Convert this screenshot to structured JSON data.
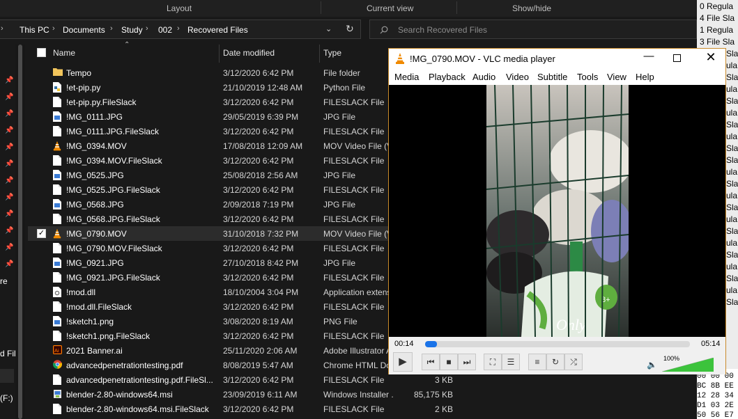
{
  "ribbon": {
    "layout": "Layout",
    "current_view": "Current view",
    "show_hide": "Show/hide"
  },
  "breadcrumbs": [
    "This PC",
    "Documents",
    "Study",
    "002",
    "Recovered Files"
  ],
  "search": {
    "placeholder": "Search Recovered Files"
  },
  "columns": {
    "name": "Name",
    "date": "Date modified",
    "type": "Type"
  },
  "files": [
    {
      "name": "Tempo",
      "date": "3/12/2020 6:42 PM",
      "type": "File folder",
      "size": "",
      "icon": "folder-icon",
      "selected": false
    },
    {
      "name": "!et-pip.py",
      "date": "21/10/2019 12:48 AM",
      "type": "Python File",
      "size": "",
      "icon": "python-file-icon",
      "selected": false
    },
    {
      "name": "!et-pip.py.FileSlack",
      "date": "3/12/2020 6:42 PM",
      "type": "FILESLACK File",
      "size": "",
      "icon": "document-icon",
      "selected": false
    },
    {
      "name": "!MG_0111.JPG",
      "date": "29/05/2019 6:39 PM",
      "type": "JPG File",
      "size": "",
      "icon": "image-file-icon",
      "selected": false
    },
    {
      "name": "!MG_0111.JPG.FileSlack",
      "date": "3/12/2020 6:42 PM",
      "type": "FILESLACK File",
      "size": "",
      "icon": "document-icon",
      "selected": false
    },
    {
      "name": "!MG_0394.MOV",
      "date": "17/08/2018 12:09 AM",
      "type": "MOV Video File (VLC)",
      "size": "",
      "icon": "vlc-cone-icon",
      "selected": false
    },
    {
      "name": "!MG_0394.MOV.FileSlack",
      "date": "3/12/2020 6:42 PM",
      "type": "FILESLACK File",
      "size": "",
      "icon": "document-icon",
      "selected": false
    },
    {
      "name": "!MG_0525.JPG",
      "date": "25/08/2018 2:56 AM",
      "type": "JPG File",
      "size": "",
      "icon": "image-file-icon",
      "selected": false
    },
    {
      "name": "!MG_0525.JPG.FileSlack",
      "date": "3/12/2020 6:42 PM",
      "type": "FILESLACK File",
      "size": "",
      "icon": "document-icon",
      "selected": false
    },
    {
      "name": "!MG_0568.JPG",
      "date": "2/09/2018 7:19 PM",
      "type": "JPG File",
      "size": "",
      "icon": "image-file-icon",
      "selected": false
    },
    {
      "name": "!MG_0568.JPG.FileSlack",
      "date": "3/12/2020 6:42 PM",
      "type": "FILESLACK File",
      "size": "",
      "icon": "document-icon",
      "selected": false
    },
    {
      "name": "!MG_0790.MOV",
      "date": "31/10/2018 7:32 PM",
      "type": "MOV Video File (VLC)",
      "size": "",
      "icon": "vlc-cone-icon",
      "selected": true
    },
    {
      "name": "!MG_0790.MOV.FileSlack",
      "date": "3/12/2020 6:42 PM",
      "type": "FILESLACK File",
      "size": "",
      "icon": "document-icon",
      "selected": false
    },
    {
      "name": "!MG_0921.JPG",
      "date": "27/10/2018 8:42 PM",
      "type": "JPG File",
      "size": "",
      "icon": "image-file-icon",
      "selected": false
    },
    {
      "name": "!MG_0921.JPG.FileSlack",
      "date": "3/12/2020 6:42 PM",
      "type": "FILESLACK File",
      "size": "",
      "icon": "document-icon",
      "selected": false
    },
    {
      "name": "!mod.dll",
      "date": "18/10/2004 3:04 PM",
      "type": "Application extension",
      "size": "",
      "icon": "dll-file-icon",
      "selected": false
    },
    {
      "name": "!mod.dll.FileSlack",
      "date": "3/12/2020 6:42 PM",
      "type": "FILESLACK File",
      "size": "",
      "icon": "document-icon",
      "selected": false
    },
    {
      "name": "!sketch1.png",
      "date": "3/08/2020 8:19 AM",
      "type": "PNG File",
      "size": "",
      "icon": "image-file-icon",
      "selected": false
    },
    {
      "name": "!sketch1.png.FileSlack",
      "date": "3/12/2020 6:42 PM",
      "type": "FILESLACK File",
      "size": "",
      "icon": "document-icon",
      "selected": false
    },
    {
      "name": "2021 Banner.ai",
      "date": "25/11/2020 2:06 AM",
      "type": "Adobe Illustrator Artwork",
      "size": "",
      "icon": "illustrator-icon",
      "selected": false
    },
    {
      "name": "advancedpenetrationtesting.pdf",
      "date": "8/08/2019 5:47 AM",
      "type": "Chrome HTML Document",
      "size": "",
      "icon": "chrome-icon",
      "selected": false
    },
    {
      "name": "advancedpenetrationtesting.pdf.FileSl...",
      "date": "3/12/2020 6:42 PM",
      "type": "FILESLACK File",
      "size": "3 KB",
      "icon": "document-icon",
      "selected": false
    },
    {
      "name": "blender-2.80-windows64.msi",
      "date": "23/09/2019 6:11 AM",
      "type": "Windows Installer ...",
      "size": "85,175 KB",
      "icon": "installer-icon",
      "selected": false
    },
    {
      "name": "blender-2.80-windows64.msi.FileSlack",
      "date": "3/12/2020 6:42 PM",
      "type": "FILESLACK File",
      "size": "2 KB",
      "icon": "document-icon",
      "selected": false
    }
  ],
  "left_edge_labels": [
    "re",
    "d Fil",
    "(F:)"
  ],
  "background_pane": {
    "lines": [
      "0  Regula",
      "4  File Sla",
      "1  Regula",
      "3  File Sla",
      "Sla",
      "ula",
      "Sla",
      "ula",
      "Sla",
      "ula",
      "Sla",
      "ula",
      "Sla",
      "Sla",
      "ula",
      "Sla",
      "ula",
      "Sla",
      "ula",
      "Sla",
      "ula",
      "Sla",
      "ula",
      "Sla",
      "ula",
      "Sla"
    ],
    "hex_lines": [
      "00 00 00",
      "BC 8B EE",
      "12 28 34",
      "D1 03 2E",
      "50 56 E7"
    ]
  },
  "vlc": {
    "title": "!MG_0790.MOV - VLC media player",
    "menu": [
      "Media",
      "Playback",
      "Audio",
      "Video",
      "Subtitle",
      "Tools",
      "View",
      "Help"
    ],
    "elapsed": "00:14",
    "total": "05:14",
    "progress": 0.045,
    "volume_label": "100%",
    "volume": 1.0,
    "accent": "#1a73e8",
    "volume_color": "#3cc33c"
  },
  "colors": {
    "explorer_bg": "#191919",
    "vlc_border": "#c98a2a"
  }
}
